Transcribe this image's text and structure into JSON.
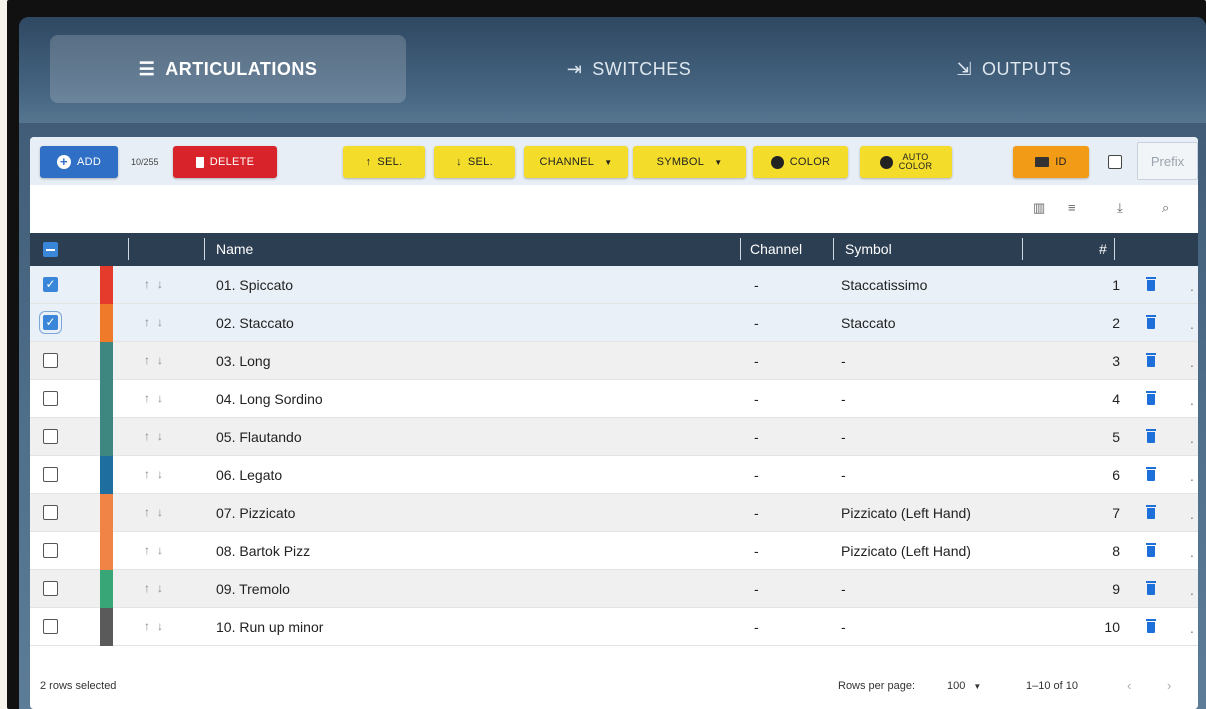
{
  "tabs": [
    {
      "label": "ARTICULATIONS",
      "icon": "list-icon",
      "glyph": "☰",
      "active": true
    },
    {
      "label": "SWITCHES",
      "icon": "switch-icon",
      "glyph": "⇥",
      "active": false
    },
    {
      "label": "OUTPUTS",
      "icon": "output-icon",
      "glyph": "⇲",
      "active": false
    }
  ],
  "toolbar": {
    "add": "ADD",
    "count": "10/255",
    "delete": "DELETE",
    "sel_up": "SEL.",
    "sel_down": "SEL.",
    "channel": "CHANNEL",
    "symbol": "SYMBOL",
    "color": "COLOR",
    "auto_color_1": "AUTO",
    "auto_color_2": "COLOR",
    "id": "ID",
    "prefix": "Prefix"
  },
  "columns": {
    "name": "Name",
    "channel": "Channel",
    "symbol": "Symbol",
    "num": "#"
  },
  "rows": [
    {
      "name": "01. Spiccato",
      "channel": "-",
      "symbol": "Staccatissimo",
      "num": "1",
      "color": "#e53b2c",
      "checked": true
    },
    {
      "name": "02. Staccato",
      "channel": "-",
      "symbol": "Staccato",
      "num": "2",
      "color": "#ef7a2a",
      "checked": true
    },
    {
      "name": "03. Long",
      "channel": "-",
      "symbol": "-",
      "num": "3",
      "color": "#3e8680",
      "checked": false
    },
    {
      "name": "04. Long Sordino",
      "channel": "-",
      "symbol": "-",
      "num": "4",
      "color": "#3e8680",
      "checked": false
    },
    {
      "name": "05. Flautando",
      "channel": "-",
      "symbol": "-",
      "num": "5",
      "color": "#3e8680",
      "checked": false
    },
    {
      "name": "06. Legato",
      "channel": "-",
      "symbol": "-",
      "num": "6",
      "color": "#1f6ea0",
      "checked": false
    },
    {
      "name": "07. Pizzicato",
      "channel": "-",
      "symbol": "Pizzicato (Left Hand)",
      "num": "7",
      "color": "#f08447",
      "checked": false
    },
    {
      "name": "08. Bartok Pizz",
      "channel": "-",
      "symbol": "Pizzicato (Left Hand)",
      "num": "8",
      "color": "#f08447",
      "checked": false
    },
    {
      "name": "09. Tremolo",
      "channel": "-",
      "symbol": "-",
      "num": "9",
      "color": "#39a678",
      "checked": false
    },
    {
      "name": "10. Run up minor",
      "channel": "-",
      "symbol": "-",
      "num": "10",
      "color": "#5a5a5a",
      "checked": false
    }
  ],
  "footer": {
    "selected": "2 rows selected",
    "rows_per_page_label": "Rows per page:",
    "rows_per_page_value": "100",
    "range": "1–10 of 10"
  }
}
